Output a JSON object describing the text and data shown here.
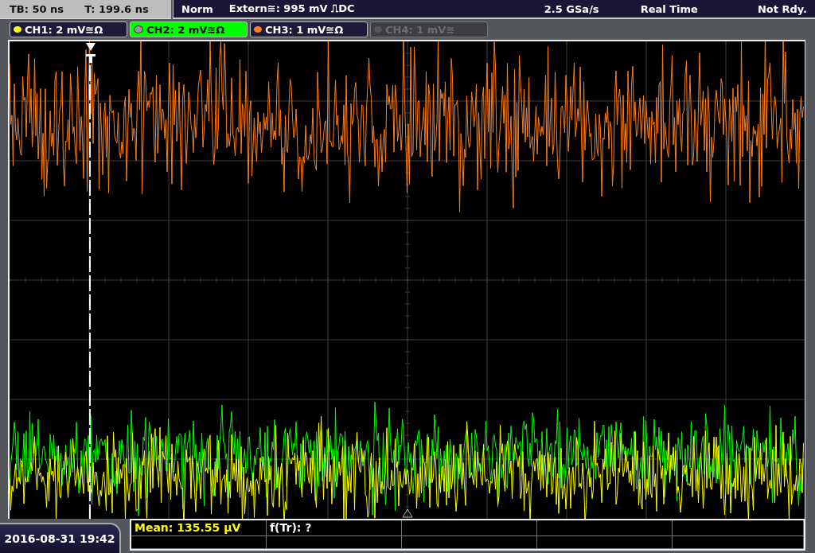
{
  "header": {
    "timebase": "TB: 50 ns",
    "trigger_time": "T: 199.6 ns",
    "trigger_mode": "Norm",
    "trigger_source": "Extern≅: 995 mV ⎍DC",
    "sample_rate": "2.5 GSa/s",
    "acquisition_mode": "Real Time",
    "status": "Not Rdy."
  },
  "channels": [
    {
      "label": "CH1: 2 mV≅Ω",
      "color": "#ffff00",
      "selected": false,
      "disabled": false
    },
    {
      "label": "CH2: 2 mV≅Ω",
      "color": "#00ff00",
      "selected": true,
      "disabled": false
    },
    {
      "label": "CH3: 1 mV≅Ω",
      "color": "#ff7f1e",
      "selected": false,
      "disabled": false
    },
    {
      "label": "CH4: 1 mV≅",
      "selected": false,
      "disabled": true
    }
  ],
  "datetime": "2016-08-31 19:42",
  "measurements": [
    {
      "text": "Mean: 135.55 µV",
      "color": "#ffff00"
    },
    {
      "text": "f(Tr): ?",
      "color": "#ffffff"
    }
  ]
}
